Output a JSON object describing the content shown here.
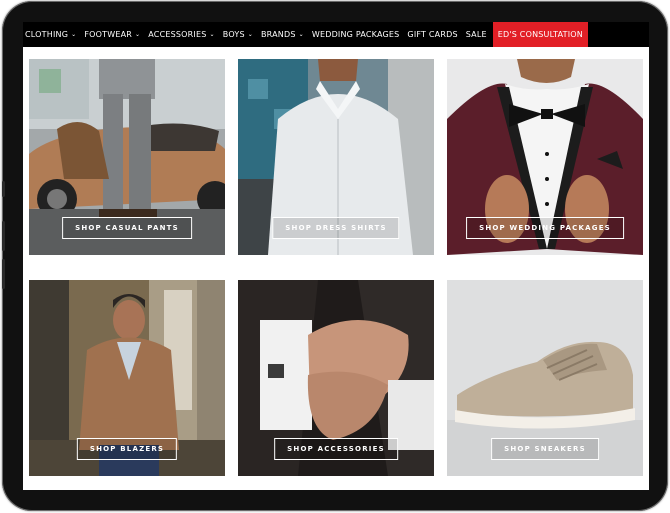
{
  "nav": {
    "items": [
      {
        "label": "CLOTHING",
        "dropdown": true
      },
      {
        "label": "FOOTWEAR",
        "dropdown": true
      },
      {
        "label": "ACCESSORIES",
        "dropdown": true
      },
      {
        "label": "BOYS",
        "dropdown": true
      },
      {
        "label": "BRANDS",
        "dropdown": true
      },
      {
        "label": "WEDDING PACKAGES",
        "dropdown": false
      },
      {
        "label": "GIFT CARDS",
        "dropdown": false
      },
      {
        "label": "SALE",
        "dropdown": false
      }
    ],
    "cta_label": "ED'S CONSULTATION",
    "cta_color": "#e21f26",
    "chevron_icon": "chevron-down-icon"
  },
  "tiles": [
    {
      "label": "SHOP CASUAL PANTS"
    },
    {
      "label": "SHOP DRESS SHIRTS"
    },
    {
      "label": "SHOP WEDDING PACKAGES"
    },
    {
      "label": "SHOP BLAZERS"
    },
    {
      "label": "SHOP ACCESSORIES"
    },
    {
      "label": "SHOP SNEAKERS"
    }
  ]
}
